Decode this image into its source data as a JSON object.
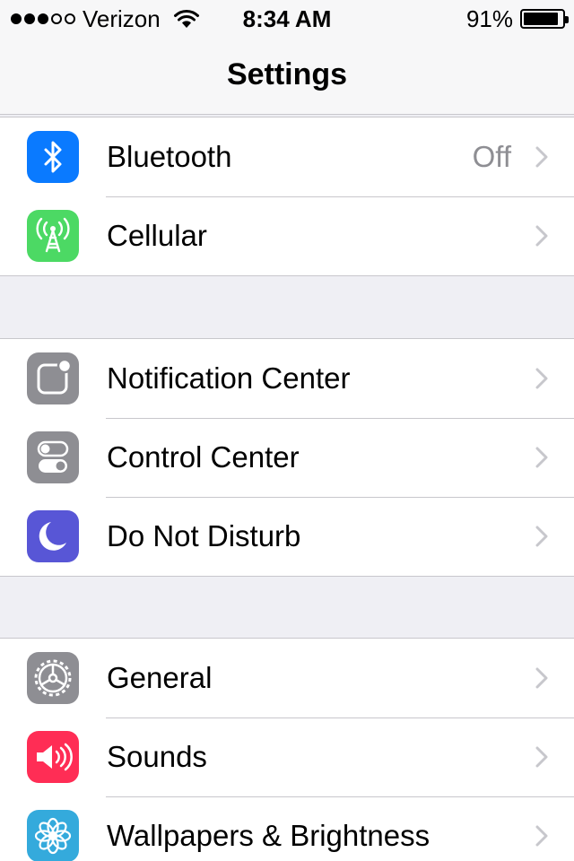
{
  "status_bar": {
    "carrier": "Verizon",
    "signal_bars_filled": 3,
    "signal_bars_total": 5,
    "time": "8:34 AM",
    "battery_text": "91%",
    "battery_level": 0.91
  },
  "nav": {
    "title": "Settings"
  },
  "colors": {
    "bluetooth": "#0a7aff",
    "cellular": "#4cd964",
    "notification_center": "#8e8e93",
    "control_center": "#8e8e93",
    "do_not_disturb": "#5856d6",
    "general": "#8e8e93",
    "sounds": "#ff2d55",
    "wallpapers": "#34aadc"
  },
  "groups": [
    {
      "items": [
        {
          "label": "Bluetooth",
          "value": "Off",
          "icon": "bluetooth-icon"
        },
        {
          "label": "Cellular",
          "value": "",
          "icon": "cellular-antenna-icon"
        }
      ]
    },
    {
      "items": [
        {
          "label": "Notification Center",
          "value": "",
          "icon": "notification-center-icon"
        },
        {
          "label": "Control Center",
          "value": "",
          "icon": "control-center-toggle-icon"
        },
        {
          "label": "Do Not Disturb",
          "value": "",
          "icon": "moon-icon"
        }
      ]
    },
    {
      "items": [
        {
          "label": "General",
          "value": "",
          "icon": "gear-icon"
        },
        {
          "label": "Sounds",
          "value": "",
          "icon": "speaker-icon"
        },
        {
          "label": "Wallpapers & Brightness",
          "value": "",
          "icon": "flower-icon"
        }
      ]
    }
  ]
}
